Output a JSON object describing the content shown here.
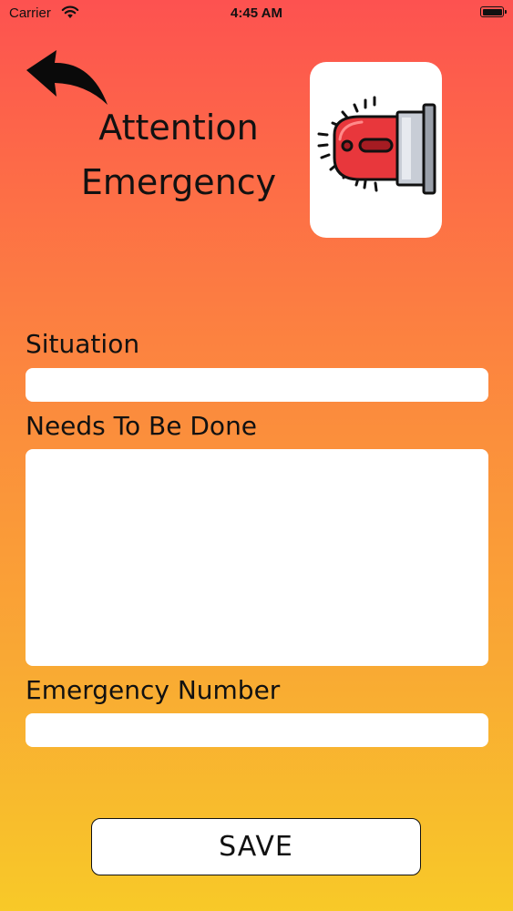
{
  "status_bar": {
    "carrier": "Carrier",
    "time": "4:45 AM",
    "wifi_icon": "wifi-icon",
    "battery_icon": "battery-icon",
    "battery_level": 1.0
  },
  "header": {
    "back_icon": "back-arrow-icon",
    "title_line1": "Attention",
    "title_line2": "Emergency",
    "siren_icon": "siren-icon"
  },
  "form": {
    "situation_label": "Situation",
    "situation_value": "",
    "needs_label": "Needs To Be Done",
    "needs_value": "",
    "number_label": "Emergency Number",
    "number_value": ""
  },
  "actions": {
    "save_label": "SAVE"
  },
  "colors": {
    "gradient_top": "#fd5250",
    "gradient_bottom": "#f8c928",
    "siren_red": "#e8373c",
    "card_background": "#ffffff"
  }
}
